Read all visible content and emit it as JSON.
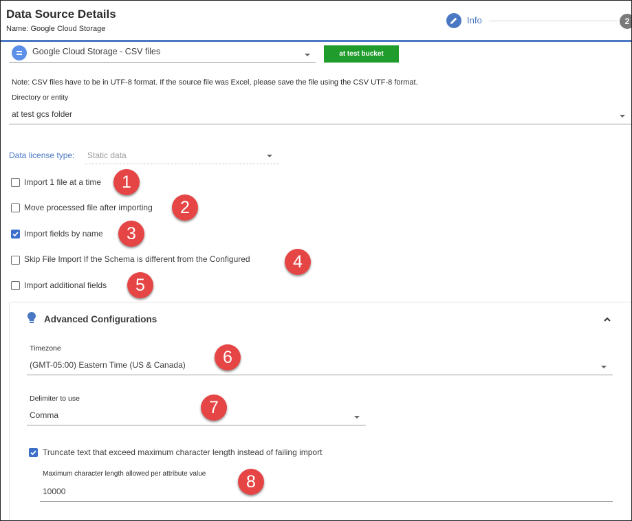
{
  "header": {
    "title": "Data Source Details",
    "subtitle": "Name: Google Cloud Storage",
    "steps": [
      {
        "label": "Info",
        "state": "active"
      },
      {
        "label": "2",
        "state": "pending"
      }
    ]
  },
  "source": {
    "selected": "Google Cloud Storage - CSV files",
    "bucket_button": "at test bucket",
    "note": "Note: CSV files have to be in UTF-8 format. If the source file was Excel, please save the file using the CSV UTF-8 format.",
    "directory_label": "Directory or entity",
    "directory_value": "at test gcs folder"
  },
  "license": {
    "label": "Data license type:",
    "value": "Static data"
  },
  "options": [
    {
      "label": "Import 1 file at a time",
      "checked": false,
      "marker": "1"
    },
    {
      "label": "Move processed file after importing",
      "checked": false,
      "marker": "2"
    },
    {
      "label": "Import fields by name",
      "checked": true,
      "marker": "3"
    },
    {
      "label": "Skip File Import If the Schema is different from the Configured",
      "checked": false,
      "marker": "4"
    },
    {
      "label": "Import additional fields",
      "checked": false,
      "marker": "5"
    }
  ],
  "advanced": {
    "title": "Advanced Configurations",
    "timezone_label": "Timezone",
    "timezone_value": "(GMT-05:00) Eastern Time (US & Canada)",
    "timezone_marker": "6",
    "delimiter_label": "Delimiter to use",
    "delimiter_value": "Comma",
    "delimiter_marker": "7",
    "truncate_label": "Truncate text that exceed maximum character length instead of failing import",
    "truncate_checked": true,
    "maxlen_label": "Maximum character length allowed per attribute value",
    "maxlen_value": "10000",
    "maxlen_marker": "8"
  },
  "colors": {
    "accent": "#4a78c2",
    "button_green": "#1f9c2c",
    "marker_red": "#e64545",
    "checkbox_blue": "#3b6fc9"
  },
  "icons": {
    "step_info": "pencil-icon",
    "source": "google-cloud-storage-icon",
    "advanced": "lightbulb-icon",
    "collapse": "chevron-up-icon"
  }
}
